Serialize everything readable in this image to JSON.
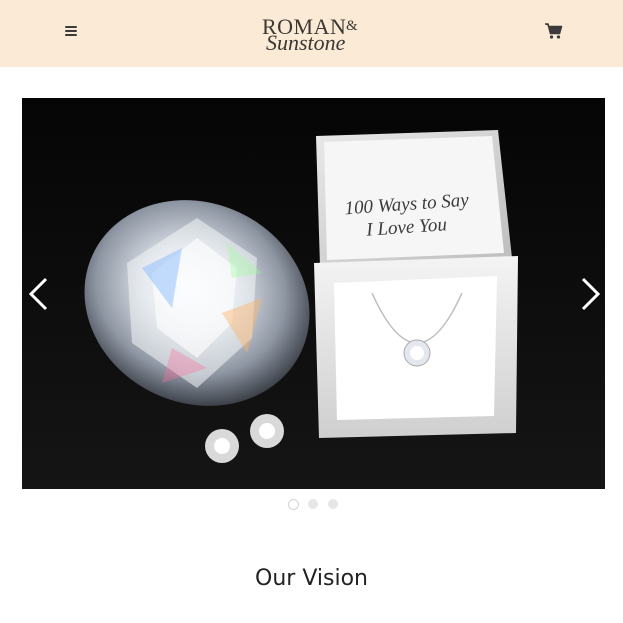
{
  "header": {
    "logo_line1": "ROMAN",
    "logo_amp": "&",
    "logo_line2": "Sunstone",
    "menu_icon": "hamburger-menu-icon",
    "cart_icon": "shopping-cart-icon",
    "background": "#fbebd6"
  },
  "carousel": {
    "box_text_line1": "100 Ways to Say",
    "box_text_line2": "I Love You",
    "prev_icon": "chevron-left-icon",
    "next_icon": "chevron-right-icon",
    "slide_count": 3,
    "active_slide": 1
  },
  "section": {
    "title": "Our Vision"
  }
}
